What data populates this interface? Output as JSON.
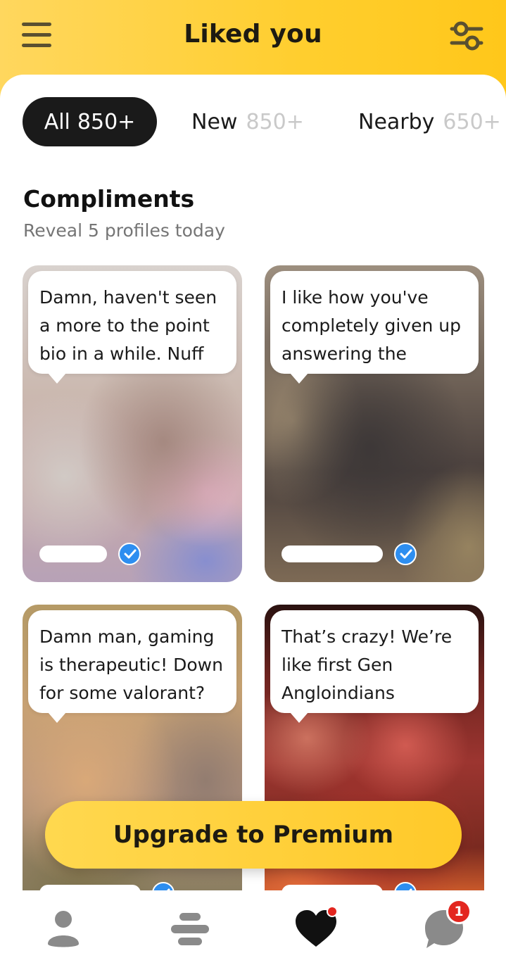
{
  "header": {
    "title": "Liked you",
    "menu_icon": "hamburger-menu-icon",
    "filter_icon": "filter-sliders-icon",
    "background_color": "#ffcf33"
  },
  "tabs": [
    {
      "label": "All",
      "count": "850+",
      "active": true
    },
    {
      "label": "New",
      "count": "850+",
      "active": false
    },
    {
      "label": "Nearby",
      "count": "650+",
      "active": false
    }
  ],
  "section": {
    "title": "Compliments",
    "subtitle": "Reveal 5 profiles today"
  },
  "cards": [
    {
      "compliment": "Damn, haven't seen a more to the point bio in a while. Nuff",
      "verified": true
    },
    {
      "compliment": "I like how you've completely given up answering the",
      "verified": true
    },
    {
      "compliment": "Damn man, gaming is therapeutic! Down for some valorant?",
      "verified": true
    },
    {
      "compliment": "That’s crazy! We’re like first Gen Angloindians",
      "verified": true
    }
  ],
  "upgrade_button": {
    "label": "Upgrade to Premium"
  },
  "bottom_nav": {
    "items": [
      {
        "icon": "profile-icon"
      },
      {
        "icon": "discover-stack-icon"
      },
      {
        "icon": "liked-you-heart-icon",
        "active": true
      },
      {
        "icon": "chat-bubble-icon",
        "badge": "1"
      }
    ]
  },
  "colors": {
    "accent": "#ffc929",
    "verified_badge": "#2d8ef0",
    "notification_badge": "#e3261f"
  }
}
